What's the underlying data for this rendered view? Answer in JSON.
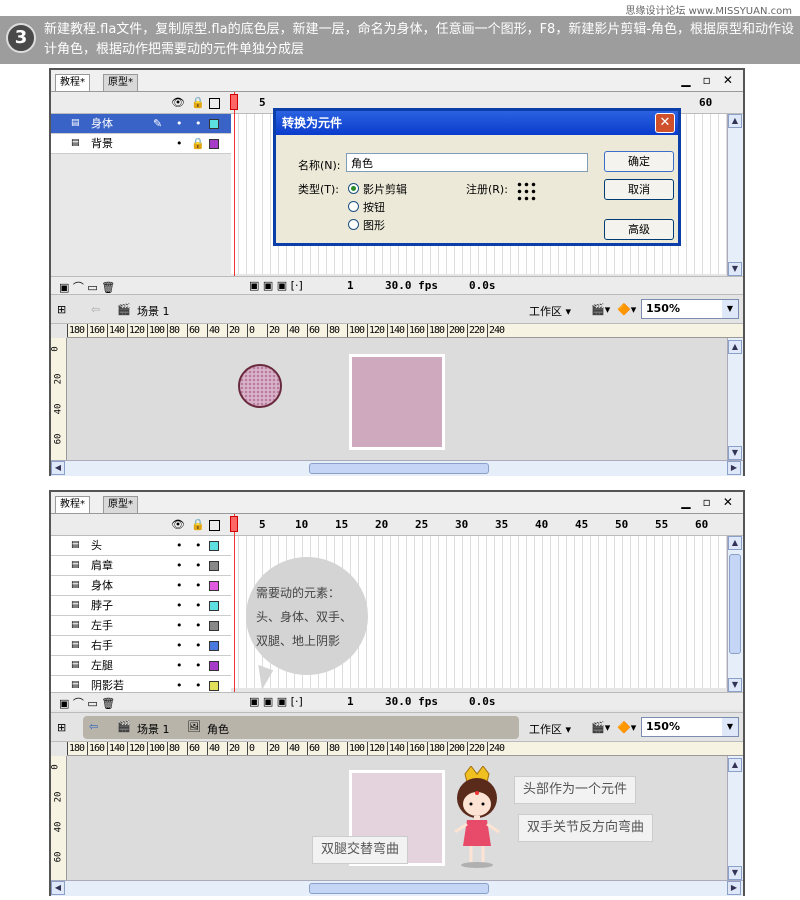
{
  "watermark": "思缘设计论坛 www.MISSYUAN.com",
  "step": {
    "number": "3",
    "text": "新建教程.fla文件，复制原型.fla的底色层，新建一层，命名为身体，任意画一个图形，F8，新建影片剪辑-角色，根据原型和动作设计角色，根据动作把需要动的元件单独分成层"
  },
  "tabs": [
    "教程*",
    "原型*"
  ],
  "frame_ticks": [
    "1",
    "5",
    "10",
    "15",
    "20",
    "25",
    "30",
    "35",
    "40",
    "45",
    "50",
    "55",
    "60"
  ],
  "window_controls": "▁ ▫ ✕",
  "panel1": {
    "layers": [
      {
        "name": "身体",
        "color": "#5de0e0",
        "pen": "✎"
      },
      {
        "name": "背景",
        "color": "#a63cc8",
        "lock": "🔒"
      }
    ],
    "footer": {
      "frame": "1",
      "fps": "30.0 fps",
      "time": "0.0s"
    },
    "scene": "场景 1",
    "workspace": "工作区",
    "zoom": "150%"
  },
  "dialog": {
    "title": "转换为元件",
    "name_label": "名称(N):",
    "name_value": "角色",
    "type_label": "类型(T):",
    "types": [
      "影片剪辑",
      "按钮",
      "图形"
    ],
    "reg_label": "注册(R):",
    "ok": "确定",
    "cancel": "取消",
    "advanced": "高级"
  },
  "ruler": [
    "180",
    "160",
    "140",
    "120",
    "100",
    "80",
    "60",
    "40",
    "20",
    "0",
    "20",
    "40",
    "60",
    "80",
    "100",
    "120",
    "140",
    "160",
    "180",
    "200",
    "220",
    "240"
  ],
  "vruler": [
    "0",
    "20",
    "40",
    "60"
  ],
  "panel2": {
    "layers": [
      {
        "name": "头",
        "color": "#5de0e0"
      },
      {
        "name": "肩章",
        "color": "#888888"
      },
      {
        "name": "身体",
        "color": "#e05ae0"
      },
      {
        "name": "脖子",
        "color": "#5de0e0"
      },
      {
        "name": "左手",
        "color": "#888888"
      },
      {
        "name": "右手",
        "color": "#4a7ae0"
      },
      {
        "name": "左腿",
        "color": "#a63cc8"
      },
      {
        "name": "阴影若",
        "color": "#e0e05a"
      }
    ],
    "footer": {
      "frame": "1",
      "fps": "30.0 fps",
      "time": "0.0s"
    },
    "scene": "场景 1",
    "symbol": "角色",
    "workspace": "工作区",
    "zoom": "150%",
    "bubble": [
      "需要动的元素：",
      "头、身体、双手、",
      "双腿、地上阴影"
    ],
    "notes": {
      "head": "头部作为一个元件",
      "hands": "双手关节反方向弯曲",
      "legs": "双腿交替弯曲"
    }
  },
  "colors": {
    "selected_layer": "#3a63c8",
    "dialog_title": "#0a3ccd",
    "square": "#cfa9bd",
    "square_light": "#e4d3dc",
    "circle": "#cfa0b8"
  }
}
